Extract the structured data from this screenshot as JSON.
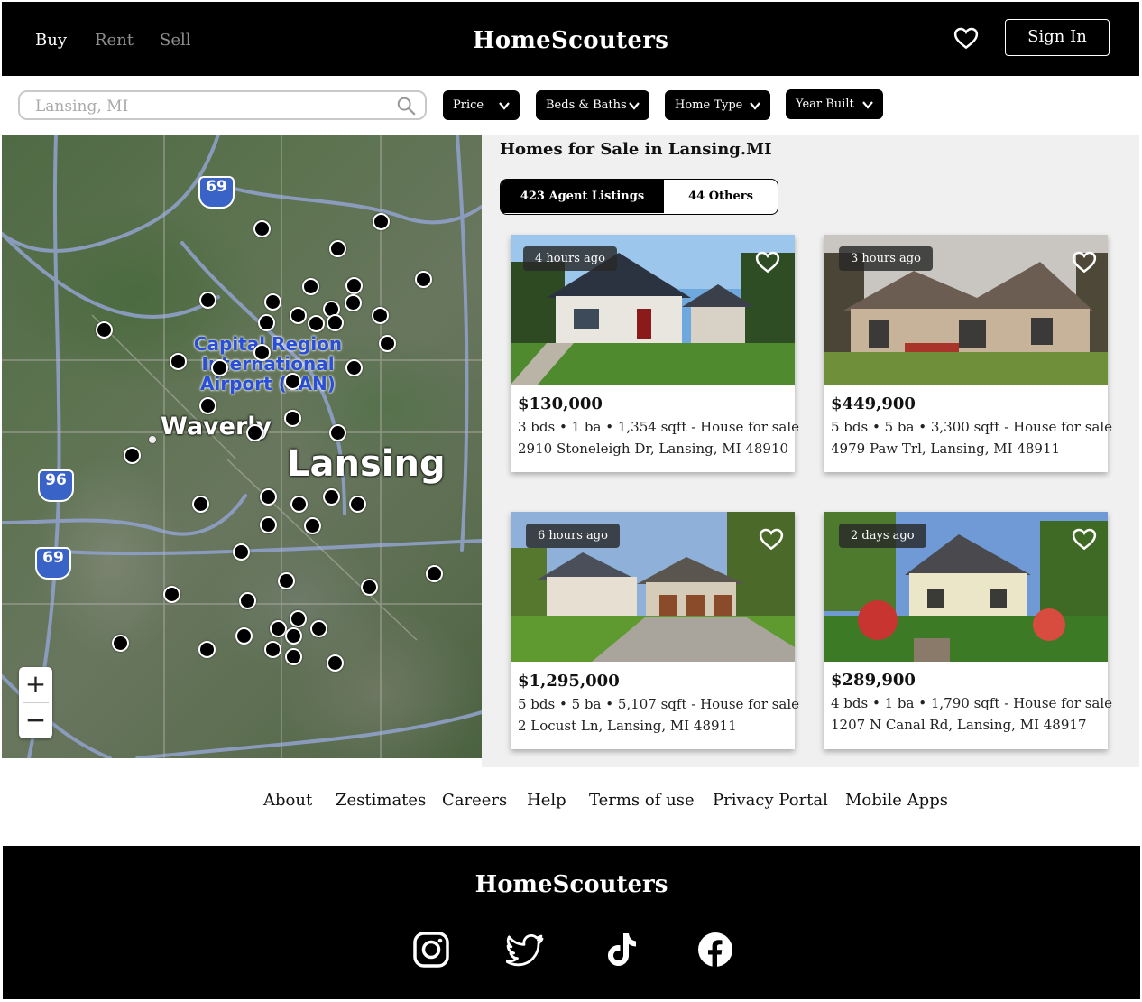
{
  "header": {
    "nav": [
      "Buy",
      "Rent",
      "Sell"
    ],
    "brand": "HomeScouters",
    "favorites_icon": "heart-icon",
    "sign_in": "Sign In"
  },
  "search": {
    "value": "Lansing, MI",
    "icon": "search-icon"
  },
  "filters": [
    "Price",
    "Beds & Baths",
    "Home Type",
    "Year Built"
  ],
  "map": {
    "labels": {
      "airport": [
        "Capital Region",
        "International",
        "Airport (LAN)"
      ],
      "waverly": "Waverly",
      "lansing": "Lansing"
    },
    "highways": [
      "69",
      "96",
      "69"
    ],
    "zoom_in": "+",
    "zoom_out": "−"
  },
  "listings": {
    "title": "Homes for Sale in Lansing.MI",
    "tabs": {
      "agent": "423 Agent Listings",
      "others": "44 Others"
    },
    "cards": [
      {
        "badge": "4 hours ago",
        "price": "$130,000",
        "beds": "3 bds",
        "baths": "1 ba",
        "sqft": "1,354 sqft",
        "type": "- House for sale",
        "address": "2910 Stoneleigh Dr, Lansing, MI 48910"
      },
      {
        "badge": "3 hours ago",
        "price": "$449,900",
        "beds": "5 bds",
        "baths": "5 ba",
        "sqft": "3,300 sqft",
        "type": "- House for sale",
        "address": "4979 Paw Trl, Lansing, MI 48911"
      },
      {
        "badge": "6 hours ago",
        "price": "$1,295,000",
        "beds": "5 bds",
        "baths": "5 ba",
        "sqft": "5,107 sqft",
        "type": "- House for sale",
        "address": "2 Locust Ln, Lansing, MI 48911"
      },
      {
        "badge": "2 days ago",
        "price": "$289,900",
        "beds": "4 bds",
        "baths": "1 ba",
        "sqft": "1,790 sqft",
        "type": "- House for sale",
        "address": "1207 N Canal Rd, Lansing, MI 48917"
      }
    ]
  },
  "footer_links": [
    "About",
    "Zestimates",
    "Careers",
    "Help",
    "Terms of use",
    "Privacy Portal",
    "Mobile Apps"
  ],
  "footer": {
    "brand": "HomeScouters",
    "social_icons": [
      "instagram-icon",
      "twitter-icon",
      "tiktok-icon",
      "facebook-icon"
    ]
  }
}
